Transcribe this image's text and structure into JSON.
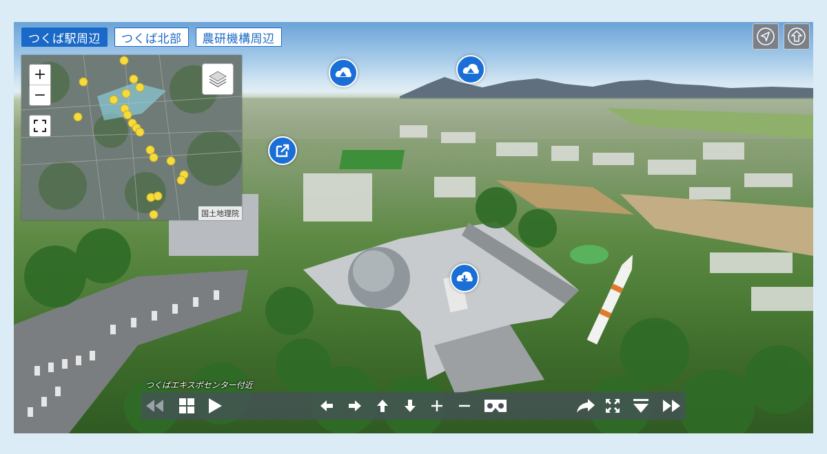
{
  "tabs": [
    {
      "label": "つくば駅周辺",
      "active": true
    },
    {
      "label": "つくば北部",
      "active": false
    },
    {
      "label": "農研機構周辺",
      "active": false
    }
  ],
  "map": {
    "zoom_in_label": "+",
    "zoom_out_label": "−",
    "attribution": "国土地理院"
  },
  "hotspots": [
    {
      "icon": "mountain-icon"
    },
    {
      "icon": "mountain-icon"
    },
    {
      "icon": "external-link-icon"
    },
    {
      "icon": "cloud-download-icon"
    }
  ],
  "corner_buttons": [
    {
      "icon": "navigation-arrow-icon"
    },
    {
      "icon": "upload-arrow-icon"
    }
  ],
  "caption": "つくばエキスポセンター付近",
  "toolbar": {
    "buttons": [
      "skip-back-icon",
      "grid-icon",
      "play-icon",
      "arrow-left-icon",
      "arrow-right-icon",
      "arrow-up-icon",
      "arrow-down-icon",
      "plus-icon",
      "minus-icon",
      "vr-icon",
      "share-icon",
      "fullscreen-icon",
      "menu-down-icon",
      "skip-forward-icon"
    ]
  },
  "colors": {
    "accent": "#1a68c7",
    "hotspot": "#1a6fd6",
    "toolbar": "#46505c"
  }
}
